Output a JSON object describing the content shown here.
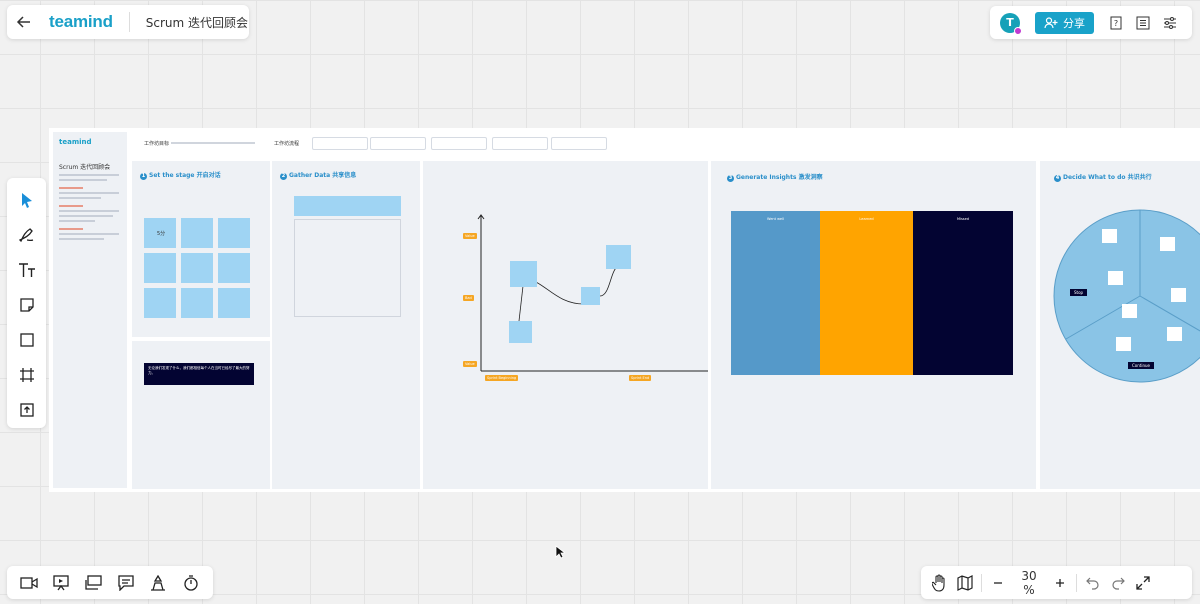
{
  "app": {
    "logo": "teamind",
    "document_title": "Scrum 迭代回顾会"
  },
  "toolbar": {
    "share_label": "分享",
    "avatar_initial": "T"
  },
  "zoom": {
    "level": "30 %"
  },
  "left_tools": [
    "select",
    "pen",
    "text",
    "sticky-note",
    "shape",
    "frame",
    "upload"
  ],
  "bottom_tools": [
    "video",
    "presentation",
    "board-view",
    "comment",
    "vote",
    "timer"
  ],
  "board": {
    "side_logo": "teamind",
    "side_title": "Scrum 迭代回顾会",
    "goal_label": "工作坊目标",
    "flow_label": "工作坊流程",
    "stage1": {
      "num": "1",
      "title": "Set the stage 开启对话",
      "note_text": "5分"
    },
    "stage2": {
      "num": "2",
      "title": "Gather Data 共享信息"
    },
    "stage3": {
      "num": "3",
      "title": "Generate Insights 激发洞察"
    },
    "stage4": {
      "num": "4",
      "title": "Decide What to do 共识共行"
    },
    "banner_text": "无论我们发现了什么，我们都相信每个人在当时已经尽了最大的努力。",
    "timeline": {
      "labels": [
        "Value",
        "Bad",
        "Value"
      ],
      "start": "Sprint Beginning",
      "end": "Sprint End"
    },
    "columns": [
      {
        "name": "Went well",
        "color": "#5599c9"
      },
      {
        "name": "Learned",
        "color": "#ffa400"
      },
      {
        "name": "Missed",
        "color": "#030432"
      }
    ],
    "pie": {
      "stop": "Stop",
      "continue": "Continue"
    }
  }
}
